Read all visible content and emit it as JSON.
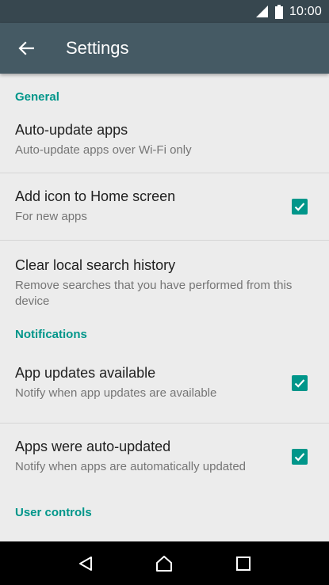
{
  "status_bar": {
    "time": "10:00"
  },
  "app_bar": {
    "title": "Settings"
  },
  "sections": {
    "general": {
      "header": "General",
      "items": [
        {
          "primary": "Auto-update apps",
          "secondary": "Auto-update apps over Wi-Fi only"
        },
        {
          "primary": "Add icon to Home screen",
          "secondary": "For new apps",
          "checked": true
        },
        {
          "primary": "Clear local search history",
          "secondary": "Remove searches that you have performed from this device"
        }
      ]
    },
    "notifications": {
      "header": "Notifications",
      "items": [
        {
          "primary": "App updates available",
          "secondary": "Notify when app updates are available",
          "checked": true
        },
        {
          "primary": "Apps were auto-updated",
          "secondary": "Notify when apps are automatically updated",
          "checked": true
        }
      ]
    },
    "user_controls": {
      "header": "User controls"
    }
  },
  "colors": {
    "accent": "#00968a",
    "app_bar": "#455a64",
    "status_bar": "#37474f",
    "background": "#ececec"
  },
  "icons": {
    "back": "arrow-back-icon",
    "nav_back": "triangle-back-icon",
    "nav_home": "home-icon",
    "nav_recents": "square-recents-icon"
  }
}
